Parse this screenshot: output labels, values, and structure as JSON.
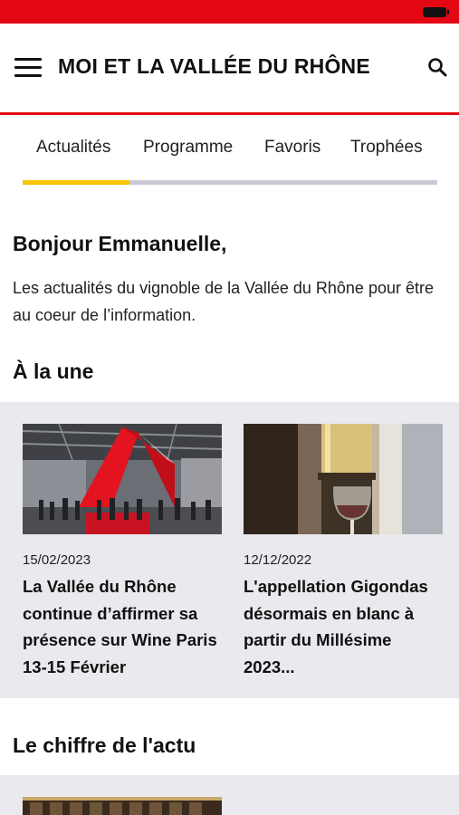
{
  "status_bar": {
    "color": "#e30613",
    "battery_icon": "battery-icon"
  },
  "header": {
    "title": "MOI ET LA VALLÉE DU RHÔNE",
    "menu_icon": "hamburger-menu-icon",
    "search_icon": "search-icon"
  },
  "tabs": [
    {
      "label": "Actualités",
      "active": true
    },
    {
      "label": "Programme",
      "active": false
    },
    {
      "label": "Favoris",
      "active": false
    },
    {
      "label": "Trophées",
      "active": false
    }
  ],
  "colors": {
    "brand_red": "#e30613",
    "active_tab_yellow": "#f5c400",
    "band_gray": "#e9e9ee"
  },
  "greeting": "Bonjour Emmanuelle,",
  "intro": "Les actualités du vignoble de la Vallée du Rhône pour être au coeur de l’information.",
  "a_la_une": {
    "title": "À la une",
    "cards": [
      {
        "date": "15/02/2023",
        "headline": "La Vallée du Rhône continue d’affirmer sa présence sur Wine Paris 13-15 Février"
      },
      {
        "date": "12/12/2022",
        "headline": "L'appellation Gigondas désormais en blanc à partir du Millésime 2023..."
      }
    ]
  },
  "chiffre": {
    "title": "Le chiffre de l'actu"
  }
}
